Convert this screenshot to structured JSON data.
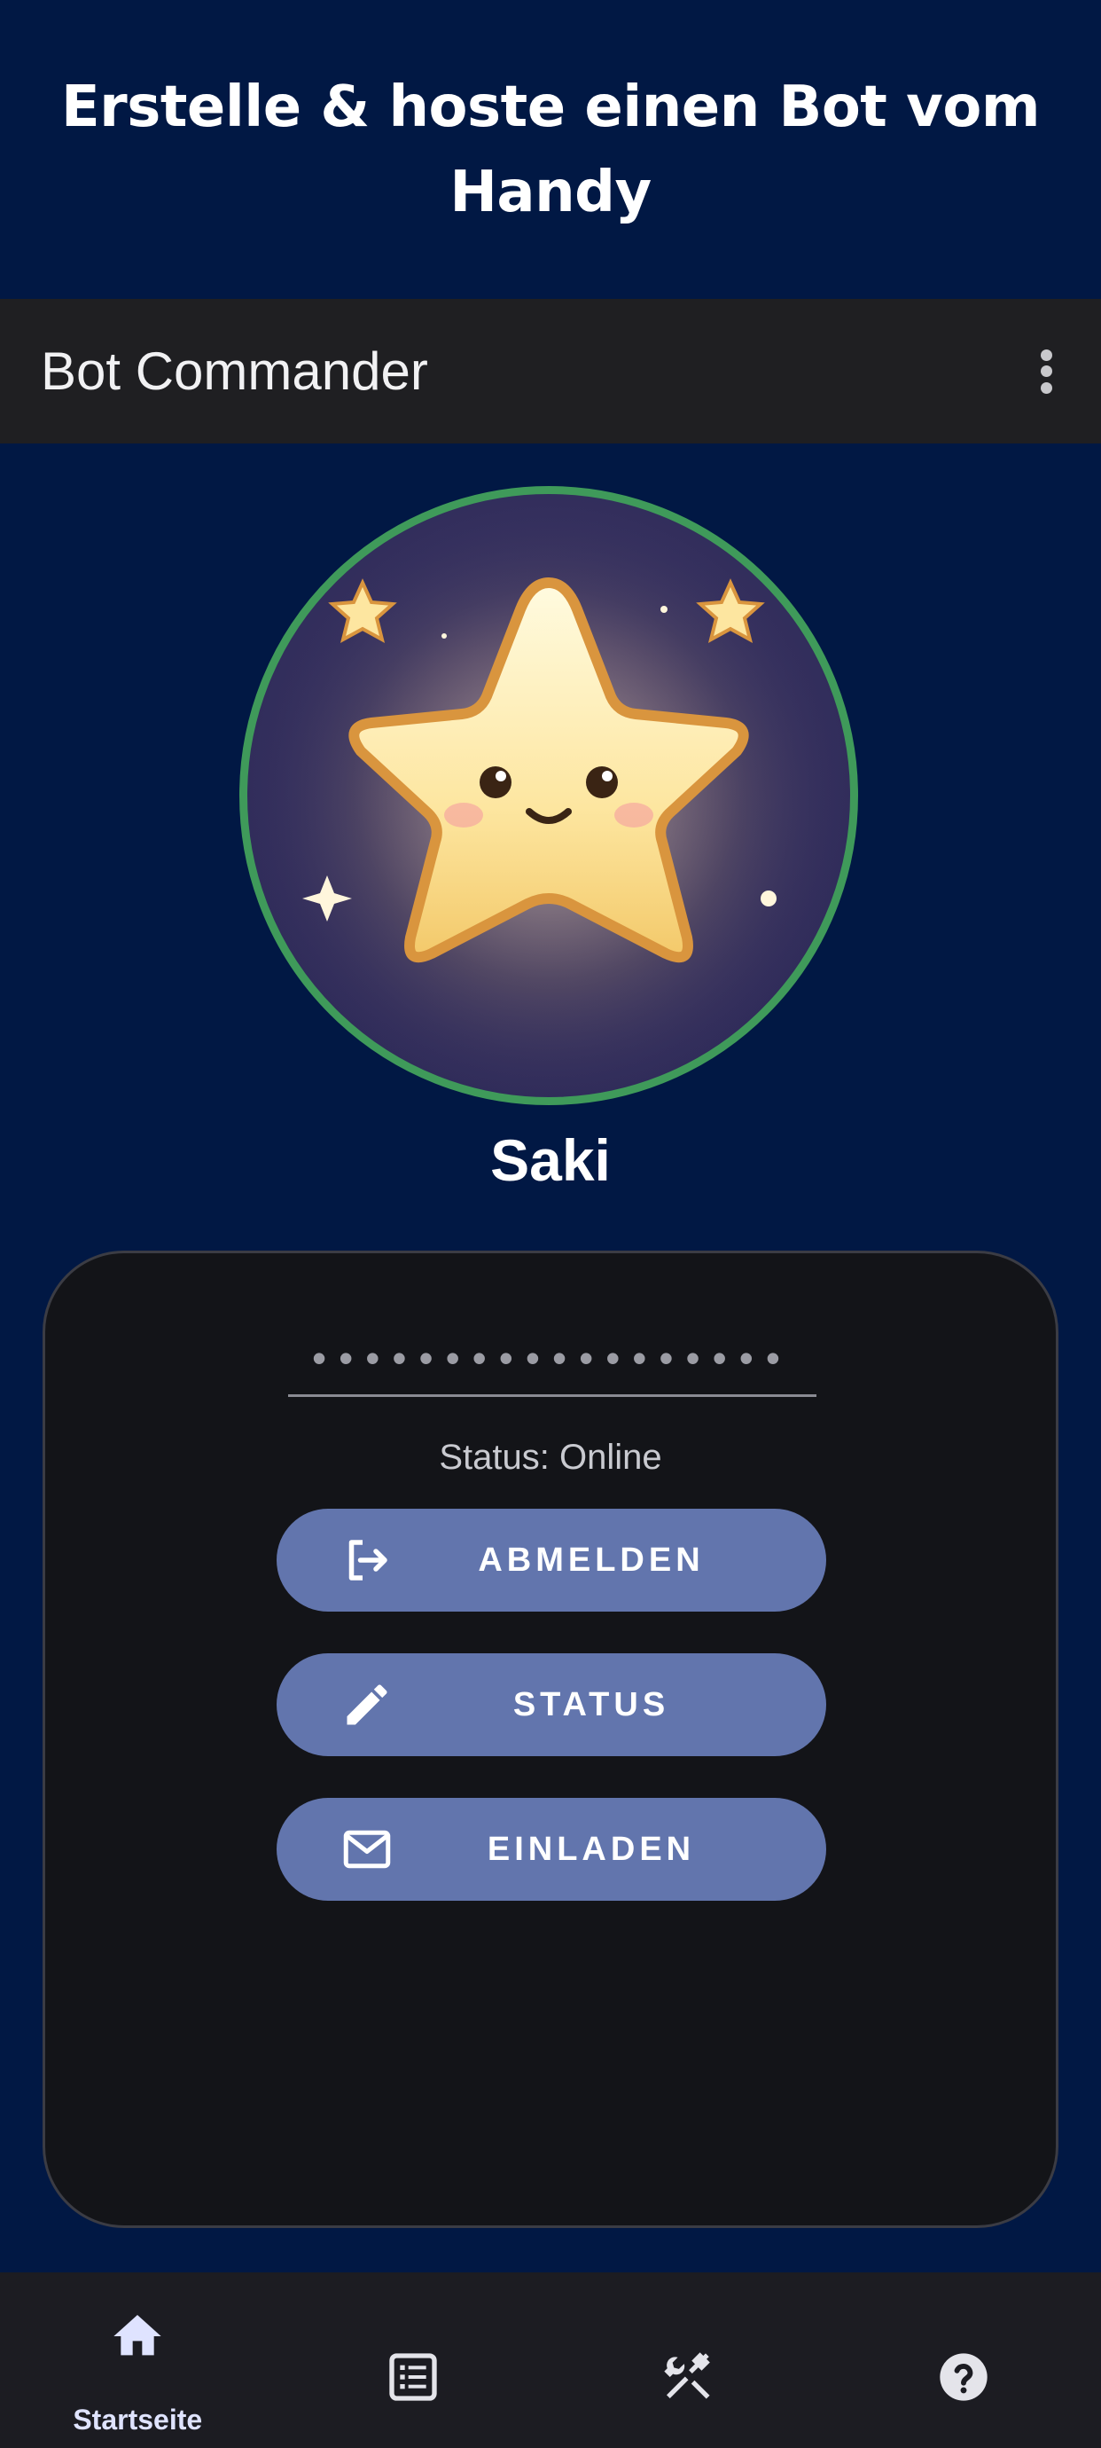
{
  "promo": {
    "title": "Erstelle & hoste einen Bot vom Handy"
  },
  "app_bar": {
    "title": "Bot Commander",
    "menu_icon": "more-vert-icon"
  },
  "profile": {
    "avatar": "kawaii-star-avatar",
    "avatar_ring_color": "#3f9a5a",
    "name": "Saki"
  },
  "card": {
    "token_masked": "••••••••••••••••••",
    "status": "Status: Online",
    "buttons": [
      {
        "label": "ABMELDEN",
        "icon": "logout-icon"
      },
      {
        "label": "STATUS",
        "icon": "pencil-icon"
      },
      {
        "label": "EINLADEN",
        "icon": "mail-icon"
      }
    ]
  },
  "bottom_nav": {
    "items": [
      {
        "label": "Startseite",
        "icon": "home-icon",
        "active": true
      },
      {
        "label": "",
        "icon": "list-icon",
        "active": false
      },
      {
        "label": "",
        "icon": "tools-icon",
        "active": false
      },
      {
        "label": "",
        "icon": "help-icon",
        "active": false
      }
    ]
  },
  "colors": {
    "background": "#011844",
    "app_bar": "#1f1f22",
    "card": "#131418",
    "button": "#6275ad",
    "active_nav": "#dfe3ff"
  }
}
